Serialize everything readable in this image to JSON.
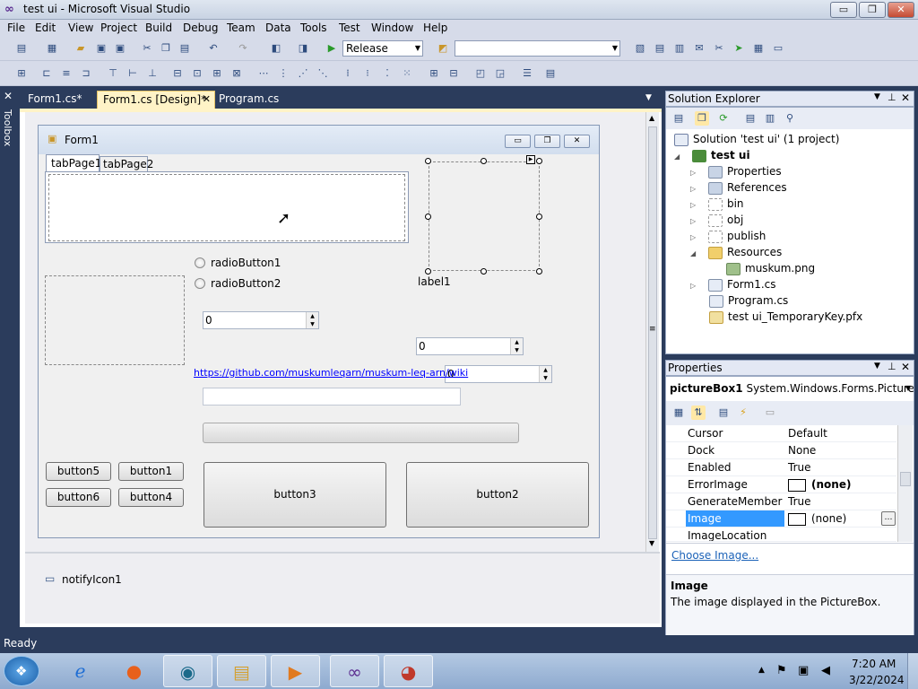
{
  "window": {
    "title": "test ui - Microsoft Visual Studio",
    "min_glyph": "▭",
    "max_glyph": "❐",
    "close_glyph": "✕"
  },
  "menu": [
    "File",
    "Edit",
    "View",
    "Project",
    "Build",
    "Debug",
    "Team",
    "Data",
    "Tools",
    "Test",
    "Window",
    "Help"
  ],
  "toolbar": {
    "config": "Release",
    "platform": ""
  },
  "toolbox": {
    "label": "Toolbox"
  },
  "tabs": [
    {
      "label": "Form1.cs*"
    },
    {
      "label": "Form1.cs [Design]*"
    },
    {
      "label": "Program.cs"
    }
  ],
  "tab_close_glyph": "✕",
  "form": {
    "title": "Form1",
    "tabs": [
      "tabPage1",
      "tabPage2"
    ],
    "radio1": "radioButton1",
    "radio2": "radioButton2",
    "label1": "label1",
    "numeric1": "0",
    "numeric2": "0",
    "numeric3": "0",
    "link": "https://github.com/muskumleqarn/muskum-leq-arn/wiki",
    "buttons": {
      "b1": "button1",
      "b2": "button2",
      "b3": "button3",
      "b4": "button4",
      "b5": "button5",
      "b6": "button6"
    },
    "progress": 0
  },
  "tray": {
    "notify_icon": "notifyIcon1"
  },
  "solution_explorer": {
    "title": "Solution Explorer",
    "solution": "Solution 'test ui' (1 project)",
    "project": "test ui",
    "items": [
      "Properties",
      "References",
      "bin",
      "obj",
      "publish",
      "Resources",
      "muskum.png",
      "Form1.cs",
      "Program.cs",
      "test ui_TemporaryKey.pfx"
    ]
  },
  "properties": {
    "title": "Properties",
    "object": "pictureBox1",
    "object_type": "System.Windows.Forms.PictureBo",
    "rows": [
      {
        "name": "Cursor",
        "value": "Default"
      },
      {
        "name": "Dock",
        "value": "None"
      },
      {
        "name": "Enabled",
        "value": "True"
      },
      {
        "name": "ErrorImage",
        "value": "(none)"
      },
      {
        "name": "GenerateMember",
        "value": "True"
      },
      {
        "name": "Image",
        "value": "(none)"
      },
      {
        "name": "ImageLocation",
        "value": ""
      }
    ],
    "link": "Choose Image...",
    "desc_title": "Image",
    "desc_text": "The image displayed in the PictureBox."
  },
  "status": "Ready",
  "clock": {
    "time": "7:20 AM",
    "date": "3/22/2024"
  },
  "colors": {
    "accent": "#2b3c5c",
    "selected": "#3399ff",
    "tab_active": "#fff3c7"
  }
}
